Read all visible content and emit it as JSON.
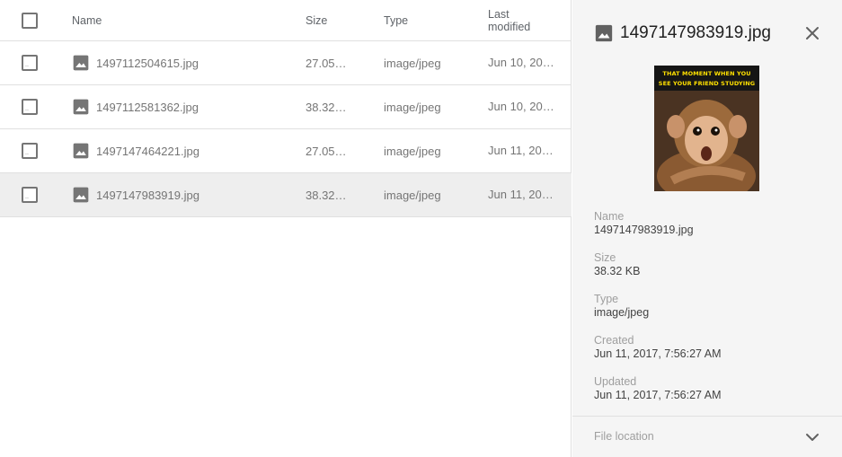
{
  "list": {
    "headers": {
      "name": "Name",
      "size": "Size",
      "type": "Type",
      "modified_line1": "Last",
      "modified_line2": "modified"
    },
    "rows": [
      {
        "name": "1497112504615.jpg",
        "size": "27.05…",
        "type": "image/jpeg",
        "modified": "Jun 10, 20…",
        "selected": false
      },
      {
        "name": "1497112581362.jpg",
        "size": "38.32…",
        "type": "image/jpeg",
        "modified": "Jun 10, 20…",
        "selected": false
      },
      {
        "name": "1497147464221.jpg",
        "size": "27.05…",
        "type": "image/jpeg",
        "modified": "Jun 11, 20…",
        "selected": false
      },
      {
        "name": "1497147983919.jpg",
        "size": "38.32…",
        "type": "image/jpeg",
        "modified": "Jun 11, 20…",
        "selected": true
      }
    ],
    "checkbox_mark": "..",
    "row_icon": "image-icon"
  },
  "detail": {
    "title": "1497147983919.jpg",
    "title_icon": "image-icon",
    "close_icon": "close-icon",
    "preview": {
      "caption_line1": "THAT MOMENT WHEN YOU",
      "caption_line2": "SEE YOUR  FRIEND STUDYING"
    },
    "properties": [
      {
        "label": "Name",
        "value": "1497147983919.jpg"
      },
      {
        "label": "Size",
        "value": "38.32 KB"
      },
      {
        "label": "Type",
        "value": "image/jpeg"
      },
      {
        "label": "Created",
        "value": "Jun 11, 2017, 7:56:27 AM"
      },
      {
        "label": "Updated",
        "value": "Jun 11, 2017, 7:56:27 AM"
      }
    ],
    "location_label": "File location",
    "location_icon": "chevron-down-icon"
  },
  "colors": {
    "selected_row": "#eeeeee",
    "detail_background": "#f5f5f5",
    "icon_gray": "#757575",
    "caption_yellow": "#ffe000"
  }
}
